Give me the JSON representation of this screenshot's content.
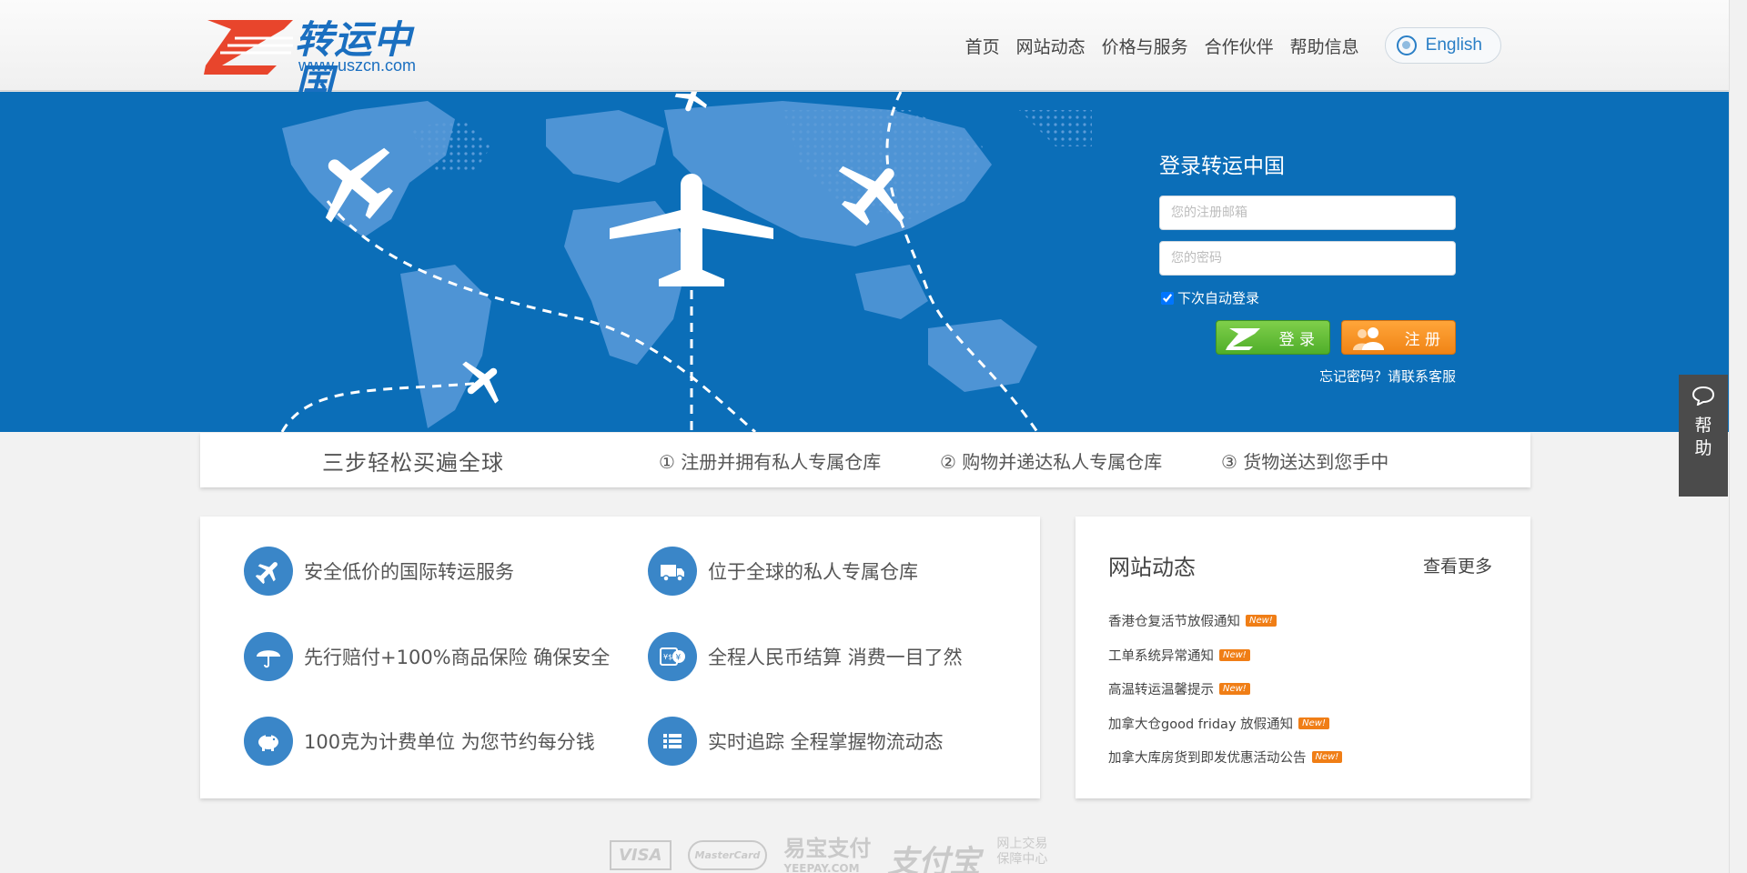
{
  "header": {
    "logo_text": "转运中国",
    "logo_url": "www.uszcn.com",
    "nav": [
      "首页",
      "网站动态",
      "价格与服务",
      "合作伙伴",
      "帮助信息"
    ],
    "lang_label": "English"
  },
  "login": {
    "title": "登录转运中国",
    "email_placeholder": "您的注册邮箱",
    "password_placeholder": "您的密码",
    "remember_label": "下次自动登录",
    "remember_checked": true,
    "login_label": "登 录",
    "register_label": "注 册",
    "forgot_label": "忘记密码？请联系客服"
  },
  "steps": {
    "headline": "三步轻松买遍全球",
    "items": [
      "① 注册并拥有私人专属仓库",
      "② 购物并递达私人专属仓库",
      "③ 货物送达到您手中"
    ]
  },
  "features": [
    {
      "icon": "airplane-icon",
      "text": "安全低价的国际转运服务"
    },
    {
      "icon": "truck-icon",
      "text": "位于全球的私人专属仓库"
    },
    {
      "icon": "umbrella-icon",
      "text": "先行赔付+100%商品保险 确保安全"
    },
    {
      "icon": "currency-card-icon",
      "text": "全程人民币结算 消费一目了然"
    },
    {
      "icon": "piggy-bank-icon",
      "text": "100克为计费单位 为您节约每分钱"
    },
    {
      "icon": "list-icon",
      "text": "实时追踪 全程掌握物流动态"
    }
  ],
  "news": {
    "title": "网站动态",
    "more_label": "查看更多",
    "badge": "New!",
    "items": [
      "香港仓复活节放假通知",
      "工单系统异常通知",
      "高温转运温馨提示",
      "加拿大仓good friday 放假通知",
      "加拿大库房货到即发优惠活动公告"
    ]
  },
  "payments": [
    "VISA",
    "MasterCard",
    "易宝支付",
    "YEEPAY.COM",
    "支付宝",
    "网上交易",
    "保障中心"
  ],
  "side_help": {
    "label": "帮助"
  },
  "colors": {
    "banner_blue": "#0b6eb8",
    "accent_blue": "#3a86c8",
    "login_green": "#4fae2a",
    "register_orange": "#f08416",
    "badge_orange": "#f07e16"
  }
}
